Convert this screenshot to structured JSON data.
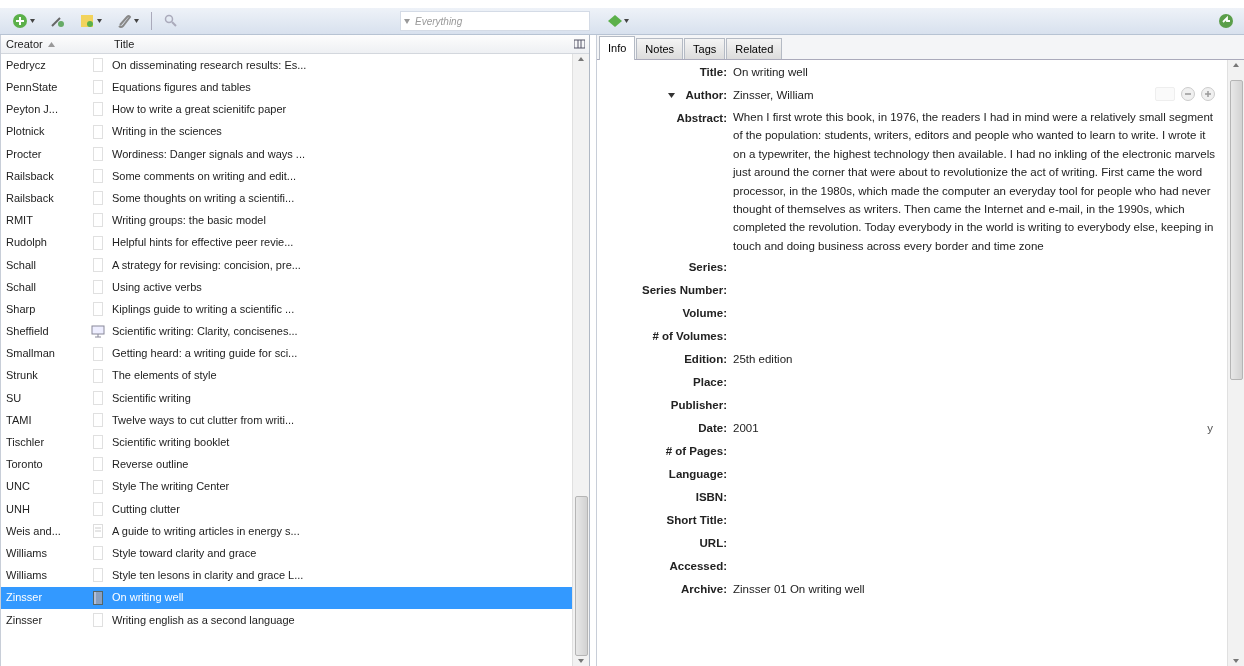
{
  "toolbar": {
    "search": {
      "placeholder": "Everything"
    }
  },
  "items_table": {
    "columns": [
      {
        "label": "Creator",
        "sorted": true
      },
      {
        "label": "Title",
        "sorted": false
      }
    ],
    "rows": [
      {
        "creator": "Pedrycz",
        "title": "On disseminating research results: Es...",
        "kind": "document",
        "selected": false
      },
      {
        "creator": "PennState",
        "title": "Equations figures and tables",
        "kind": "document",
        "selected": false
      },
      {
        "creator": "Peyton J...",
        "title": "How to write a great scienitifc paper",
        "kind": "document",
        "selected": false
      },
      {
        "creator": "Plotnick",
        "title": "Writing in the sciences",
        "kind": "document",
        "selected": false
      },
      {
        "creator": "Procter",
        "title": "Wordiness: Danger signals and ways ...",
        "kind": "document",
        "selected": false
      },
      {
        "creator": "Railsback",
        "title": "Some comments on writing and edit...",
        "kind": "document",
        "selected": false
      },
      {
        "creator": "Railsback",
        "title": "Some thoughts on writing a scientifi...",
        "kind": "document",
        "selected": false
      },
      {
        "creator": "RMIT",
        "title": "Writing groups: the basic model",
        "kind": "document",
        "selected": false
      },
      {
        "creator": "Rudolph",
        "title": "Helpful hints for effective peer revie...",
        "kind": "document",
        "selected": false
      },
      {
        "creator": "Schall",
        "title": "A strategy for revising: concision, pre...",
        "kind": "document",
        "selected": false
      },
      {
        "creator": "Schall",
        "title": "Using active verbs",
        "kind": "document",
        "selected": false
      },
      {
        "creator": "Sharp",
        "title": "Kiplings guide to writing a scientific ...",
        "kind": "document",
        "selected": false
      },
      {
        "creator": "Sheffield",
        "title": "Scientific writing: Clarity, concisenes...",
        "kind": "presentation",
        "selected": false
      },
      {
        "creator": "Smallman",
        "title": "Getting heard: a writing guide for sci...",
        "kind": "document",
        "selected": false
      },
      {
        "creator": "Strunk",
        "title": "The elements of style",
        "kind": "document",
        "selected": false
      },
      {
        "creator": "SU",
        "title": "Scientific writing",
        "kind": "document",
        "selected": false
      },
      {
        "creator": "TAMI",
        "title": "Twelve ways to cut clutter from writi...",
        "kind": "document",
        "selected": false
      },
      {
        "creator": "Tischler",
        "title": "Scientific writing booklet",
        "kind": "document",
        "selected": false
      },
      {
        "creator": "Toronto",
        "title": "Reverse outline",
        "kind": "document",
        "selected": false
      },
      {
        "creator": "UNC",
        "title": "Style The writing Center",
        "kind": "document",
        "selected": false
      },
      {
        "creator": "UNH",
        "title": "Cutting clutter",
        "kind": "document",
        "selected": false
      },
      {
        "creator": "Weis and...",
        "title": "A guide to writing articles in energy s...",
        "kind": "article",
        "selected": false
      },
      {
        "creator": "Williams",
        "title": "Style toward clarity and grace",
        "kind": "document",
        "selected": false
      },
      {
        "creator": "Williams",
        "title": "Style ten lesons in clarity and grace L...",
        "kind": "document",
        "selected": false
      },
      {
        "creator": "Zinsser",
        "title": "On writing well",
        "kind": "book",
        "selected": true
      },
      {
        "creator": "Zinsser",
        "title": "Writing english as a second language",
        "kind": "document",
        "selected": false
      }
    ]
  },
  "item_pane": {
    "tabs": [
      {
        "label": "Info",
        "selected": true
      },
      {
        "label": "Notes",
        "selected": false
      },
      {
        "label": "Tags",
        "selected": false
      },
      {
        "label": "Related",
        "selected": false
      }
    ],
    "fields": [
      {
        "label": "Title:",
        "value": "On writing well",
        "kind": "text"
      },
      {
        "label": "Author:",
        "value": "Zinsser, William",
        "kind": "creator"
      },
      {
        "label": "Abstract:",
        "value": "When I first wrote this book, in 1976, the readers I had in mind were a relatively small segment of the population: students, writers, editors and people who wanted to learn to write. I wrote it on a typewriter, the highest technology then available. I had no inkling of the electronic marvels just around the corner that were about to revolutionize the act of writing. First came the word processor, in the 1980s, which made the computer an everyday tool for people who had never thought of themselves as writers. Then came the Internet and e-mail, in the 1990s, which completed the revolution. Today everybody in the world is writing to everybody else, keeping in touch and doing business across every border and time zone",
        "kind": "text"
      },
      {
        "label": "Series:",
        "kind": "text"
      },
      {
        "label": "Series Number:",
        "kind": "text"
      },
      {
        "label": "Volume:",
        "kind": "text"
      },
      {
        "label": "# of Volumes:",
        "kind": "text"
      },
      {
        "label": "Edition:",
        "value": "25th edition",
        "kind": "text"
      },
      {
        "label": "Place:",
        "kind": "text"
      },
      {
        "label": "Publisher:",
        "kind": "text"
      },
      {
        "label": "Date:",
        "value": "2001",
        "kind": "date",
        "date_format": "y"
      },
      {
        "label": "# of Pages:",
        "kind": "text"
      },
      {
        "label": "Language:",
        "kind": "text"
      },
      {
        "label": "ISBN:",
        "kind": "text"
      },
      {
        "label": "Short Title:",
        "kind": "text"
      },
      {
        "label": "URL:",
        "kind": "text"
      },
      {
        "label": "Accessed:",
        "kind": "text"
      },
      {
        "label": "Archive:",
        "value": "Zinsser 01 On writing well",
        "kind": "text"
      }
    ]
  }
}
